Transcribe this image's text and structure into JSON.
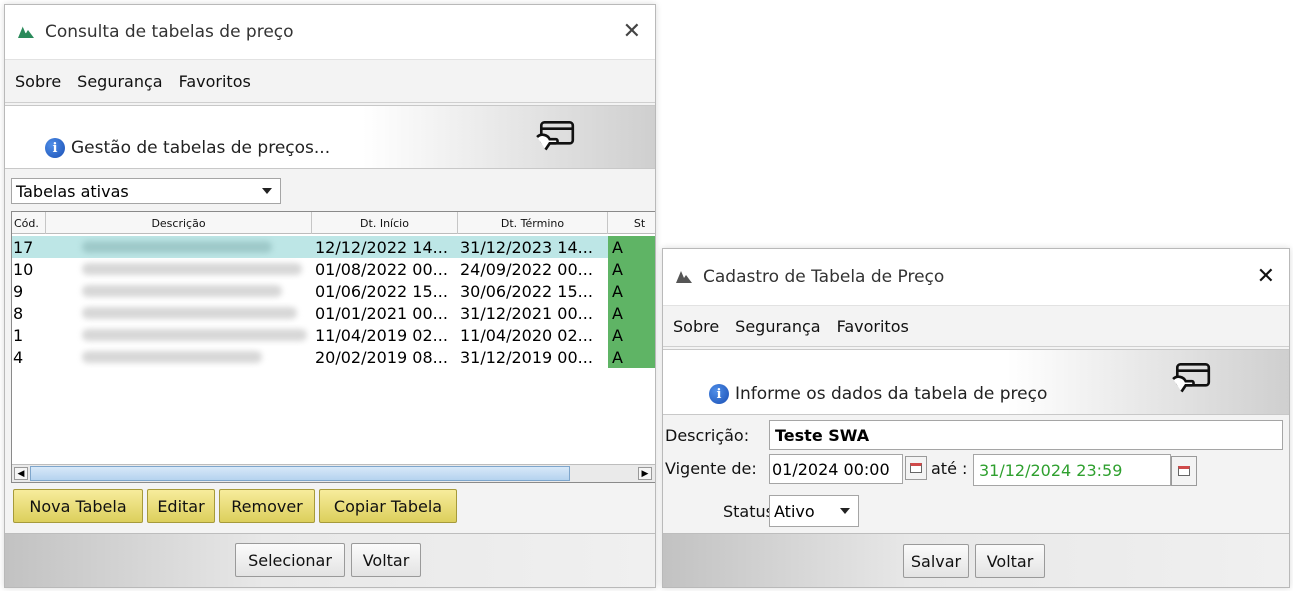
{
  "win1": {
    "title": "Consulta de tabelas de preço",
    "menu": [
      "Sobre",
      "Segurança",
      "Favoritos"
    ],
    "banner_msg": "Gestão de tabelas de preços...",
    "filter_selected": "Tabelas ativas",
    "columns": [
      "Cód.",
      "Descrição",
      "Dt. Início",
      "Dt. Término",
      "St"
    ],
    "rows": [
      {
        "cod": "17",
        "inicio": "12/12/2022 14...",
        "termino": "31/12/2023 14...",
        "st": "A"
      },
      {
        "cod": "10",
        "inicio": "01/08/2022 00...",
        "termino": "24/09/2022 00...",
        "st": "A"
      },
      {
        "cod": "9",
        "inicio": "01/06/2022 15...",
        "termino": "30/06/2022 15...",
        "st": "A"
      },
      {
        "cod": "8",
        "inicio": "01/01/2021 00...",
        "termino": "31/12/2021 00...",
        "st": "A"
      },
      {
        "cod": "1",
        "inicio": "11/04/2019 02...",
        "termino": "11/04/2020 02...",
        "st": "A"
      },
      {
        "cod": "4",
        "inicio": "20/02/2019 08...",
        "termino": "31/12/2019 00...",
        "st": "A"
      }
    ],
    "buttons": {
      "nova": "Nova Tabela",
      "editar": "Editar",
      "remover": "Remover",
      "copiar": "Copiar Tabela"
    },
    "bottom": {
      "selecionar": "Selecionar",
      "voltar": "Voltar"
    }
  },
  "win2": {
    "title": "Cadastro de Tabela de Preço",
    "menu": [
      "Sobre",
      "Segurança",
      "Favoritos"
    ],
    "banner_msg": "Informe os dados da tabela de preço",
    "descricao_label": "Descrição:",
    "descricao_value": "Teste SWA",
    "vigente_label": "Vigente de:",
    "vigente_de": "01/2024 00:00",
    "ate_label": "até :",
    "vigente_ate": "31/12/2024 23:59",
    "status_label": "Status:",
    "status_value": "Ativo",
    "bottom": {
      "salvar": "Salvar",
      "voltar": "Voltar"
    }
  }
}
